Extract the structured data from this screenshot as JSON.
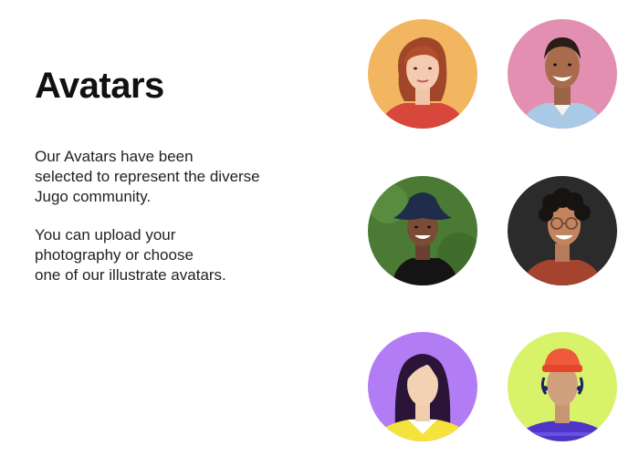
{
  "heading": "Avatars",
  "description": "Our Avatars have been\nselected to represent the diverse\nJugo community.",
  "upload_text": "You can upload your\nphotography or choose\none of our illustrate avatars.",
  "avatars": [
    {
      "kind": "photo",
      "background": "#f2b661"
    },
    {
      "kind": "photo",
      "background": "#e38fb2"
    },
    {
      "kind": "photo",
      "background": "#4a7a34"
    },
    {
      "kind": "photo",
      "background": "#2b2b2b"
    },
    {
      "kind": "illustration",
      "background": "#b27cf5"
    },
    {
      "kind": "illustration",
      "background": "#d8f36a"
    }
  ]
}
